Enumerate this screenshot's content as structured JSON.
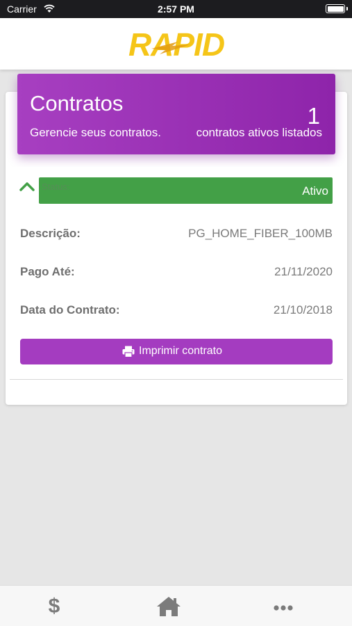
{
  "status_bar": {
    "carrier": "Carrier",
    "time": "2:57 PM"
  },
  "header": {
    "logo_text": "RAPID",
    "logo_color": "#f5c518"
  },
  "banner": {
    "title": "Contratos",
    "subtitle": "Gerencie seus contratos.",
    "count": "1",
    "count_label": "contratos ativos listados",
    "color": "#9c33b8"
  },
  "contract": {
    "status_label": "Status:",
    "status_value": "Ativo",
    "status_color": "#43a047",
    "fields": [
      {
        "label": "Descrição:",
        "value": "PG_HOME_FIBER_100MB"
      },
      {
        "label": "Pago Até:",
        "value": "21/11/2020"
      },
      {
        "label": "Data do Contrato:",
        "value": "21/10/2018"
      }
    ],
    "print_button": "Imprimir contrato"
  },
  "tabbar": {
    "items": [
      {
        "icon": "dollar-icon",
        "glyph": "$"
      },
      {
        "icon": "home-icon"
      },
      {
        "icon": "more-icon"
      }
    ]
  }
}
